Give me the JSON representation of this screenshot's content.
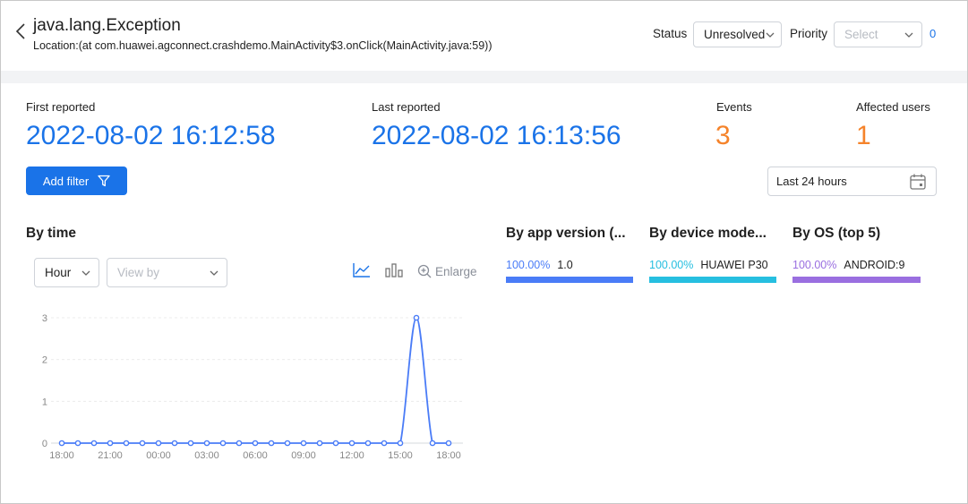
{
  "header": {
    "title": "java.lang.Exception",
    "location": "Location:(at com.huawei.agconnect.crashdemo.MainActivity$3.onClick(MainActivity.java:59))",
    "status_label": "Status",
    "status_value": "Unresolved",
    "priority_label": "Priority",
    "priority_placeholder": "Select",
    "count": "0"
  },
  "stats": {
    "first_reported_label": "First reported",
    "first_reported_value": "2022-08-02 16:12:58",
    "last_reported_label": "Last reported",
    "last_reported_value": "2022-08-02 16:13:56",
    "events_label": "Events",
    "events_value": "3",
    "affected_users_label": "Affected users",
    "affected_users_value": "1"
  },
  "toolbar": {
    "add_filter_label": "Add filter",
    "time_range": "Last 24 hours"
  },
  "by_time": {
    "title": "By time",
    "granularity": "Hour",
    "view_by_placeholder": "View by",
    "enlarge_label": "Enlarge"
  },
  "distributions": [
    {
      "title": "By app version (...",
      "percent": "100.00%",
      "name": "1.0",
      "color": "#4a7cf7",
      "share": 1.0
    },
    {
      "title": "By device mode...",
      "percent": "100.00%",
      "name": "HUAWEI P30",
      "color": "#26bfe0",
      "share": 1.0
    },
    {
      "title": "By OS (top 5)",
      "percent": "100.00%",
      "name": "ANDROID:9",
      "color": "#9a6fe0",
      "share": 1.0
    }
  ],
  "colors": {
    "accent": "#1a73e8",
    "highlight": "#f5832a",
    "line": "#4a7cf7"
  },
  "chart_data": {
    "type": "line",
    "x_ticks": [
      "18:00",
      "21:00",
      "00:00",
      "03:00",
      "06:00",
      "09:00",
      "12:00",
      "15:00",
      "18:00"
    ],
    "y_ticks": [
      "0",
      "1",
      "2",
      "3"
    ],
    "ylim": [
      0,
      3
    ],
    "grid": true,
    "series": [
      {
        "values": [
          0,
          0,
          0,
          0,
          0,
          0,
          0,
          0,
          0,
          0,
          0,
          0,
          0,
          0,
          0,
          0,
          0,
          0,
          0,
          0,
          0,
          0,
          3,
          0,
          0
        ]
      }
    ]
  }
}
